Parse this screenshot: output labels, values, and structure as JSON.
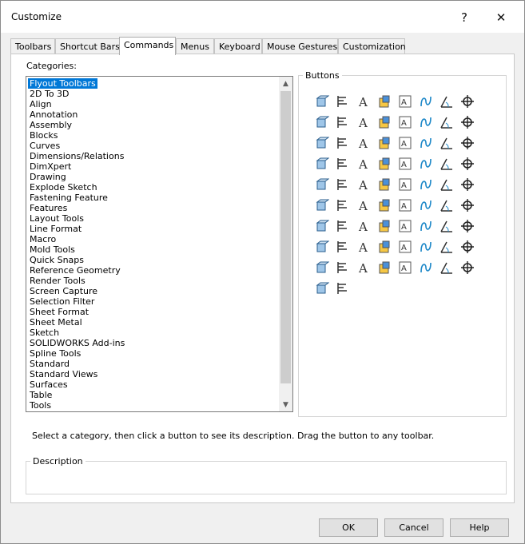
{
  "window": {
    "title": "Customize",
    "help_glyph": "?",
    "close_glyph": "✕"
  },
  "tabs": [
    {
      "label": "Toolbars",
      "active": false
    },
    {
      "label": "Shortcut Bars",
      "active": false
    },
    {
      "label": "Commands",
      "active": true
    },
    {
      "label": "Menus",
      "active": false
    },
    {
      "label": "Keyboard",
      "active": false
    },
    {
      "label": "Mouse Gestures",
      "active": false
    },
    {
      "label": "Customization",
      "active": false
    }
  ],
  "categories": {
    "label": "Categories:",
    "selected": "Flyout Toolbars",
    "items": [
      "Flyout Toolbars",
      "2D To 3D",
      "Align",
      "Annotation",
      "Assembly",
      "Blocks",
      "Curves",
      "Dimensions/Relations",
      "DimXpert",
      "Drawing",
      "Explode Sketch",
      "Fastening Feature",
      "Features",
      "Layout Tools",
      "Line Format",
      "Macro",
      "Mold Tools",
      "Quick Snaps",
      "Reference Geometry",
      "Render Tools",
      "Screen Capture",
      "Selection Filter",
      "Sheet Format",
      "Sheet Metal",
      "Sketch",
      "SOLIDWORKS Add-ins",
      "Spline Tools",
      "Standard",
      "Standard Views",
      "Surfaces",
      "Table",
      "Tools"
    ]
  },
  "buttons_panel": {
    "label": "Buttons",
    "icons": [
      "flyout-3d-cube-icon",
      "align-left-icon",
      "text-style-icon",
      "colored-cube-icon",
      "note-icon",
      "curve-icon",
      "angle-dimension-icon",
      "crosshair-icon",
      "save-block-icon",
      "insert-block-icon",
      "cube-view-icon",
      "stack-icon",
      "plane-icon",
      "color-bars-icon",
      "document-arrow-icon",
      "hole-icon",
      "circle-dot-icon",
      "reference-plane-icon",
      "color-wheel-icon",
      "document-image-icon",
      "filter-icon",
      "table-icon",
      "sheet-icon",
      "sheet-corner-icon",
      "red-cube-icon",
      "spline-curve-icon",
      "blank-page-icon",
      "paste-icon",
      "open-folder-icon",
      "surface-icon",
      "grid-table-icon",
      "magnify-icon",
      "globe-icon",
      "open-file-icon",
      "page-icon",
      "import-icon",
      "save-icon",
      "print-icon",
      "gear-icon",
      "corner-icon",
      "line-icon",
      "rectangle-icon",
      "slot-icon",
      "circle-icon",
      "arc-icon",
      "ellipse-icon",
      "spline-icon",
      "fillet-icon",
      "cube-outline-icon",
      "explode-icon",
      "move-arrow-icon",
      "pattern-icon",
      "point-axis-icon",
      "rotate-arrow-icon",
      "part-icon",
      "assembly-icon",
      "extrude-icon",
      "linear-pattern-icon",
      "bend-icon",
      "folder-part-icon",
      "pattern-grid-icon",
      "mold-icon",
      "bolt-icon",
      "swap-arrows-icon",
      "text-aaa-icon",
      "monitor-icon",
      "check-x-icon",
      "fastener-icon",
      "layered-cube-icon",
      "exploded-line-icon",
      "blue-cube-icon",
      "flash-cube-icon",
      "dimension-arrow-icon",
      "buildings-icon"
    ]
  },
  "hint_text": "Select a category, then click a button to see its description. Drag the button to any toolbar.",
  "description": {
    "label": "Description",
    "text": ""
  },
  "dialog_buttons": {
    "ok": "OK",
    "cancel": "Cancel",
    "help": "Help"
  },
  "colors": {
    "selection": "#0078d7",
    "dialog_bg": "#f0f0f0",
    "accent_blue": "#1e88c8"
  }
}
